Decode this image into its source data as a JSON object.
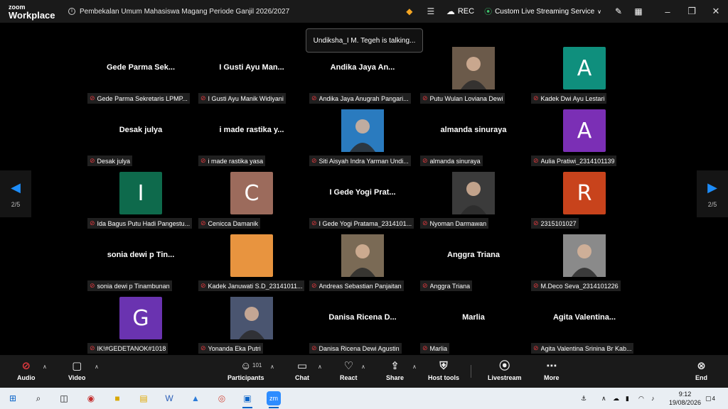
{
  "app": {
    "brand_line1": "zoom",
    "brand_line2": "Workplace"
  },
  "meeting": {
    "title": "Pembekalan Umum Mahasiswa Magang Periode Ganjil 2026/2027"
  },
  "titlebar": {
    "rec_label": "REC",
    "stream_label": "Custom Live Streaming Service"
  },
  "talking": "Undiksha_I M. Tegeh is talking...",
  "pager": {
    "left": "2/5",
    "right": "2/5"
  },
  "tiles": [
    {
      "big": "Gede Parma Sek...",
      "label": "Gede Parma Sekretaris LPMP..."
    },
    {
      "big": "I Gusti Ayu Man...",
      "label": "I Gusti Ayu Manik Widiyani"
    },
    {
      "big": "Andika Jaya An...",
      "label": "Andika Jaya Anugrah Pangari..."
    },
    {
      "big": "",
      "label": "Putu Wulan Loviana Dewi"
    },
    {
      "big": "",
      "initial": "A",
      "color": "#0f8f7d",
      "label": "Kadek Dwi Ayu Lestari"
    },
    {
      "big": "Desak julya",
      "label": "Desak julya"
    },
    {
      "big": "i made rastika y...",
      "label": "i made rastika yasa"
    },
    {
      "big": "",
      "label": "Siti Aisyah Indra Yarman Undi..."
    },
    {
      "big": "almanda sinuraya",
      "label": "almanda sinuraya"
    },
    {
      "big": "",
      "initial": "A",
      "color": "#7b2fb5",
      "label": "Aulia Pratiwi_2314101139"
    },
    {
      "big": "",
      "initial": "I",
      "color": "#0e6a4c",
      "label": "Ida Bagus Putu Hadi Pangestu..."
    },
    {
      "big": "",
      "initial": "C",
      "color": "#9c6b5c",
      "label": "Cenicca Damanik"
    },
    {
      "big": "I Gede Yogi Prat...",
      "label": "I Gede Yogi Pratama_2314101..."
    },
    {
      "big": "",
      "label": "Nyoman Darmawan"
    },
    {
      "big": "",
      "initial": "R",
      "color": "#c8431c",
      "label": "2315101027"
    },
    {
      "big": "sonia dewi p Tin...",
      "label": "sonia dewi p Tinambunan"
    },
    {
      "big": "",
      "initial": "",
      "color": "#e8943f",
      "label": "Kadek Januwati S.D_23141011..."
    },
    {
      "big": "",
      "label": "Andreas Sebastian Panjaitan"
    },
    {
      "big": "Anggra Triana",
      "label": "Anggra Triana"
    },
    {
      "big": "",
      "label": "M.Deco Seva_2314101226"
    },
    {
      "big": "",
      "initial": "G",
      "color": "#6a33b0",
      "label": "IK!#GEDETANOK#1018"
    },
    {
      "big": "",
      "label": "Yonanda Eka Putri"
    },
    {
      "big": "Danisa Ricena D...",
      "label": "Danisa Ricena Dewi Agustin"
    },
    {
      "big": "Marlia",
      "label": "Marlia"
    },
    {
      "big": "Agita Valentina...",
      "label": "Agita Valentina Srinina Br Kab..."
    }
  ],
  "controls": {
    "audio": "Audio",
    "video": "Video",
    "participants": "Participants",
    "participant_count": "101",
    "chat": "Chat",
    "react": "React",
    "share": "Share",
    "host_tools": "Host tools",
    "livestream": "Livestream",
    "more": "More",
    "end": "End"
  },
  "taskbar": {
    "time": "9:12",
    "date": "19/08/2026",
    "notifications": "4"
  }
}
